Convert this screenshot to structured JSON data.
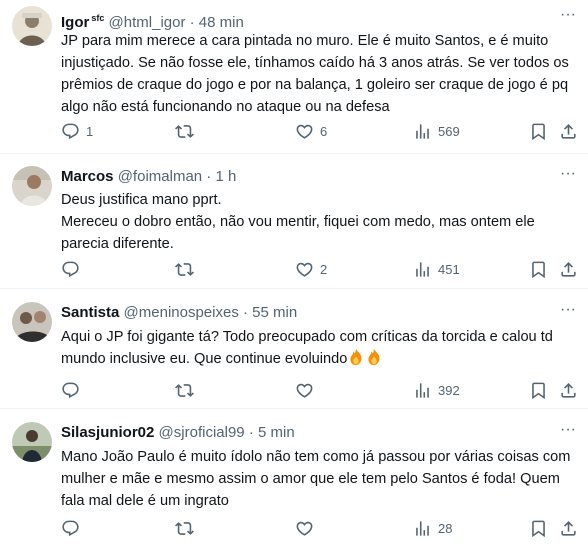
{
  "tweets": [
    {
      "name": "Igor",
      "badge": "sfc",
      "handle": "@html_igor",
      "dot": "·",
      "time": "48 min",
      "text": "JP para mim merece a cara pintada no muro. Ele é muito Santos, e é muito injustiçado. Se não fosse ele, tínhamos caído há 3 anos atrás. Se ver todos os prêmios de craque do jogo e por na balança, 1 goleiro ser craque de jogo é pq algo não está funcionando no ataque ou na defesa",
      "replies": "1",
      "retweets": "",
      "likes": "6",
      "views": "569"
    },
    {
      "name": "Marcos",
      "badge": "",
      "handle": "@foimalman",
      "dot": "·",
      "time": "1 h",
      "text_line1": "Deus justifica mano pprt.",
      "text_line2": "Mereceu o dobro então, não vou mentir, fiquei com medo, mas ontem ele parecia diferente.",
      "replies": "",
      "retweets": "",
      "likes": "2",
      "views": "451"
    },
    {
      "name": "Santista",
      "badge": "",
      "handle": "@meninospeixes",
      "dot": "·",
      "time": "55 min",
      "text": "Aqui o JP foi gigante tá? Todo preocupado com críticas da torcida e calou td mundo inclusive eu. Que continue evoluindo",
      "emoji": "fire-emoji x2",
      "replies": "",
      "retweets": "",
      "likes": "",
      "views": "392"
    },
    {
      "name": "Silasjunior02",
      "badge": "",
      "handle": "@sjroficial99",
      "dot": "·",
      "time": "5 min",
      "text": "Mano João Paulo é muito ídolo não tem como já passou por várias coisas com mulher e mãe e mesmo assim o amor que ele tem pelo Santos é foda! Quem fala mal dele é um ingrato",
      "replies": "",
      "retweets": "",
      "likes": "",
      "views": "28"
    }
  ],
  "more_label": "···",
  "colors": {
    "text": "#0f1419",
    "secondary": "#536471",
    "divider": "#eff3f4"
  }
}
